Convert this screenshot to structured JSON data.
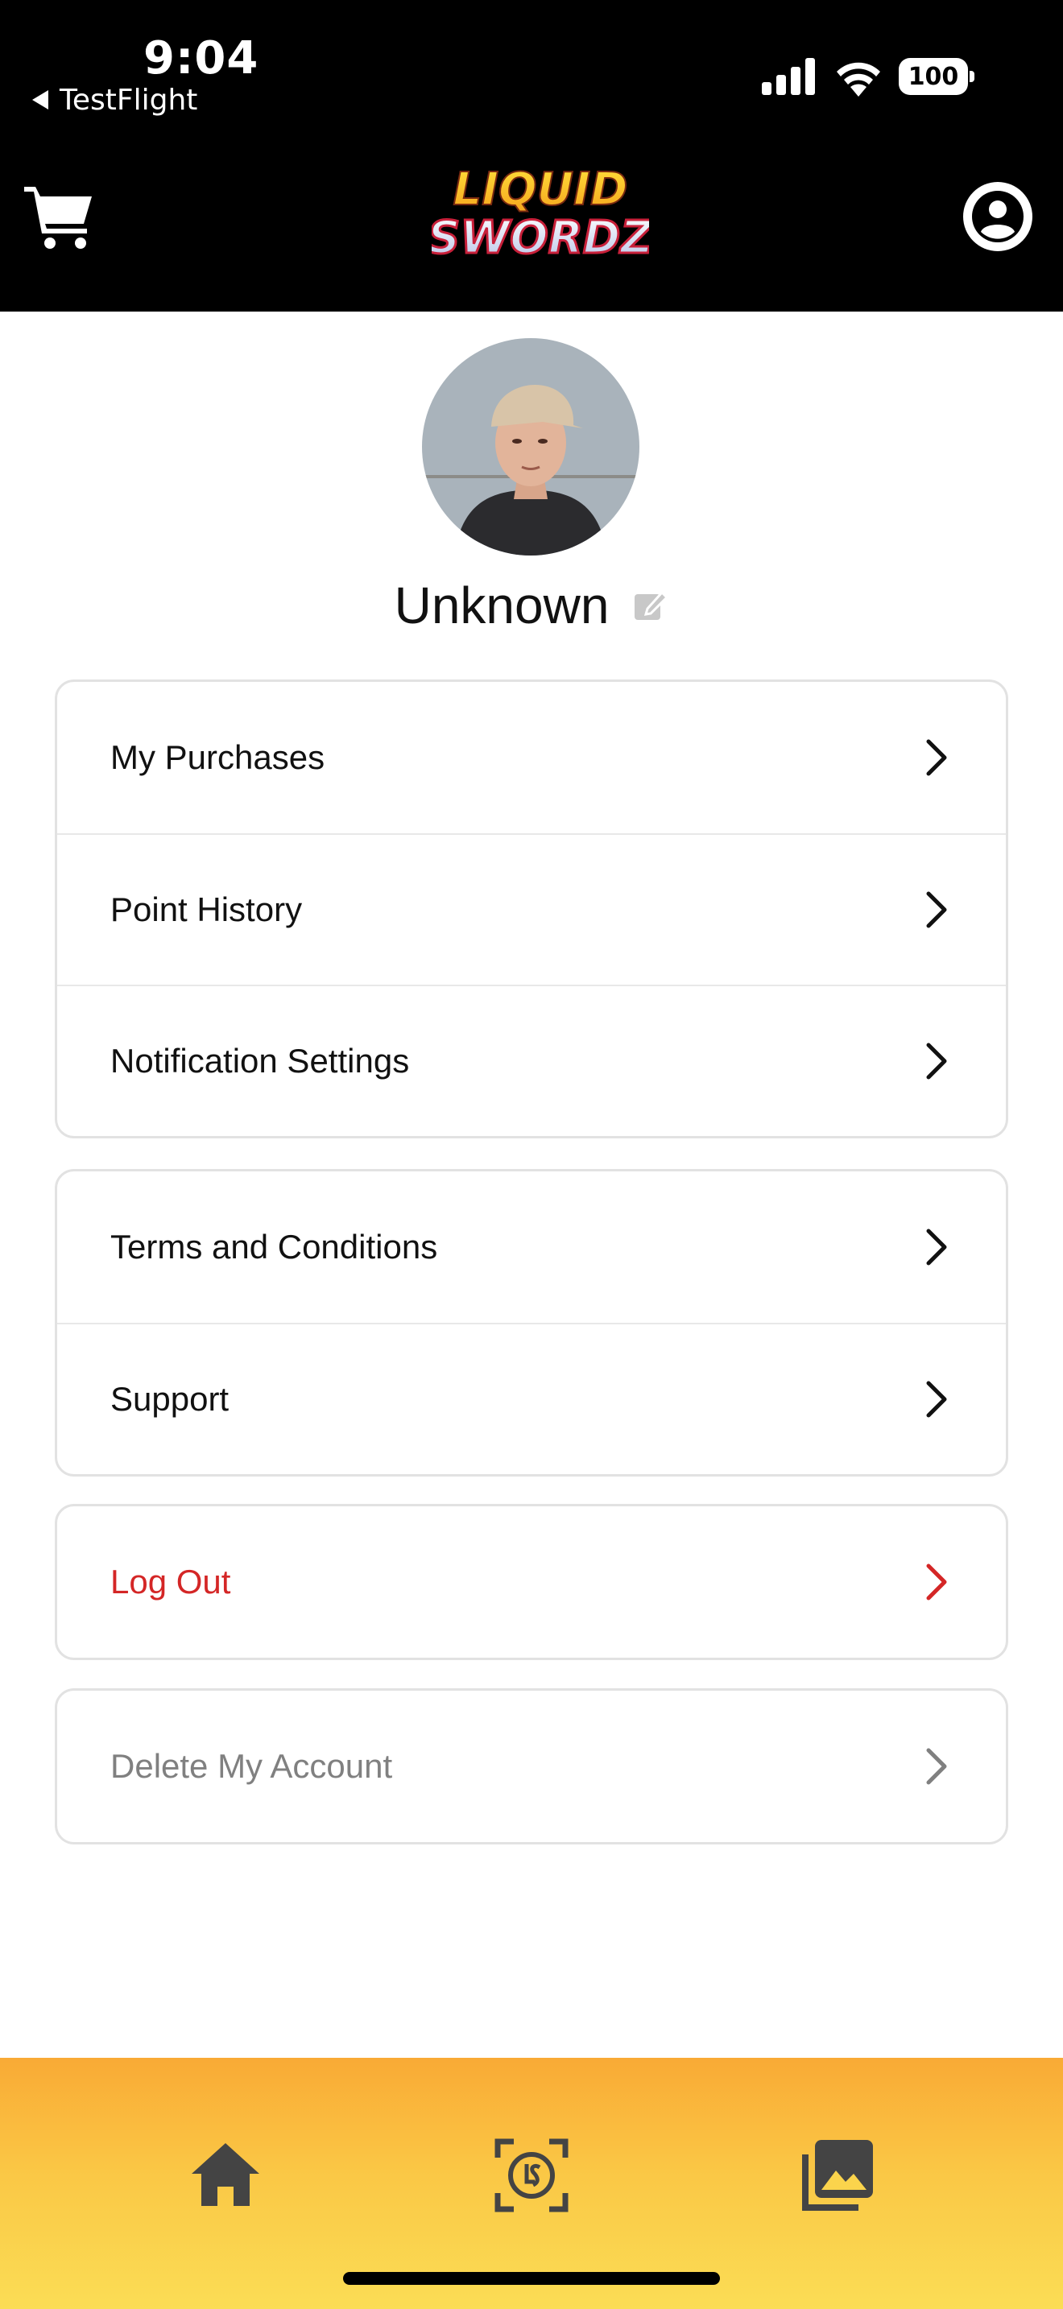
{
  "status_bar": {
    "time": "9:04",
    "back_app": "TestFlight",
    "battery": "100"
  },
  "header": {
    "logo_line1": "LIQUID",
    "logo_line2": "SWORDZ",
    "left_icon": "cart-icon",
    "right_icon": "account-icon"
  },
  "profile": {
    "name": "Unknown",
    "edit_icon": "edit-icon"
  },
  "menu": {
    "group1": [
      "My Purchases",
      "Point History",
      "Notification Settings"
    ],
    "group2": [
      "Terms and Conditions",
      "Support"
    ],
    "logout": "Log Out",
    "delete": "Delete My Account"
  },
  "colors": {
    "header_bg": "#000000",
    "danger": "#d42626",
    "muted": "#808080",
    "tabbar_top": "#f9aa35",
    "tabbar_bottom": "#fbdd55"
  },
  "tab_bar": {
    "items": [
      "home-icon",
      "scan-coin-icon",
      "gallery-icon"
    ]
  }
}
